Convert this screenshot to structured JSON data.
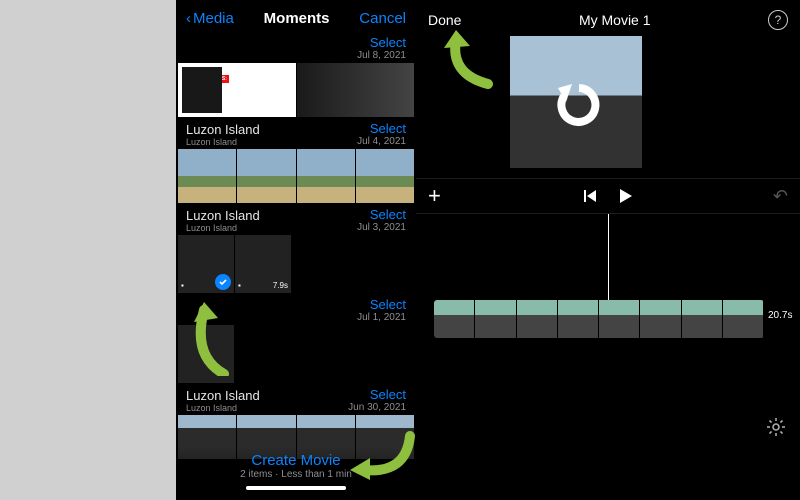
{
  "left": {
    "nav": {
      "back": "Media",
      "title": "Moments",
      "cancel": "Cancel"
    },
    "groups": [
      {
        "select": "Select",
        "date": "Jul 8, 2021"
      },
      {
        "loc": "Luzon Island",
        "subloc": "Luzon Island",
        "select": "Select",
        "date": "Jul 4, 2021"
      },
      {
        "loc": "Luzon Island",
        "subloc": "Luzon Island",
        "select": "Select",
        "date": "Jul 3, 2021",
        "clip_dur": "7.9s"
      },
      {
        "select": "Select",
        "date": "Jul 1, 2021"
      },
      {
        "loc": "Luzon Island",
        "subloc": "Luzon Island",
        "select": "Select",
        "date": "Jun 30, 2021"
      }
    ],
    "create_label": "Create Movie",
    "create_meta": "2 items · Less than 1 min",
    "gospel_text": "THE GOSPEL IS:"
  },
  "right": {
    "done": "Done",
    "title": "My Movie 1",
    "clip_dur": "20.7s"
  },
  "icons": {
    "chev_left": "‹",
    "video": "■",
    "help": "?",
    "plus": "+",
    "undo": "↶"
  },
  "colors": {
    "accent": "#0a84ff",
    "arrow": "#8fbf3f"
  }
}
